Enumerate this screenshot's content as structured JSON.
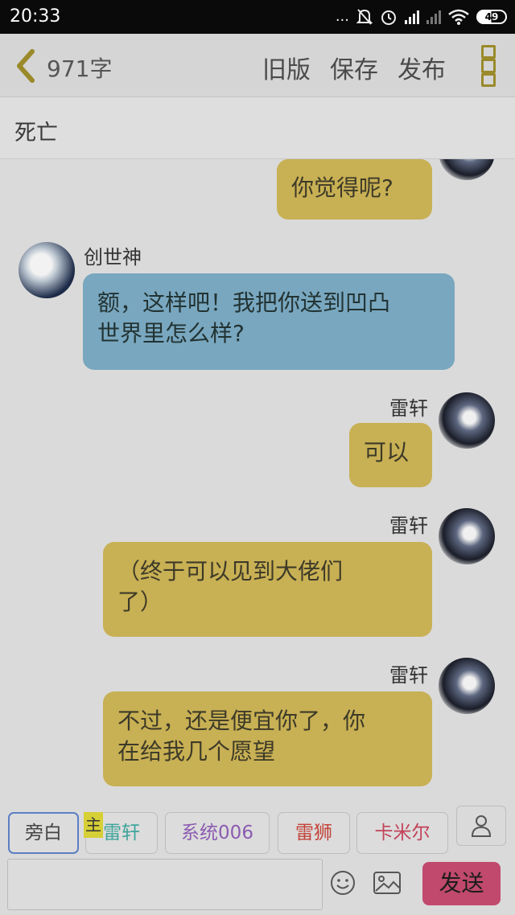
{
  "status_bar": {
    "time": "20:33",
    "battery": "49",
    "dots": "..."
  },
  "header": {
    "word_count": "971字",
    "old_version": "旧版",
    "save": "保存",
    "publish": "发布"
  },
  "chapter": {
    "title": "死亡"
  },
  "messages": [
    {
      "speaker": "",
      "side": "right",
      "text": "你觉得呢?"
    },
    {
      "speaker": "创世神",
      "side": "left",
      "text_lines": [
        "额，这样吧！我把你送到凹凸",
        "世界里怎么样?"
      ]
    },
    {
      "speaker": "雷轩",
      "side": "right",
      "text": "可以"
    },
    {
      "speaker": "雷轩",
      "side": "right",
      "text_lines": [
        "（终于可以见到大佬们",
        "了）"
      ]
    },
    {
      "speaker": "雷轩",
      "side": "right",
      "text_lines": [
        "不过，还是便宜你了，你",
        "在给我几个愿望"
      ]
    }
  ],
  "roles": {
    "narration": "旁白",
    "host_badge": "主",
    "items": [
      {
        "label": "雷轩",
        "color": "#3fa59b"
      },
      {
        "label": "系统006",
        "color": "#8c5bb0"
      },
      {
        "label": "雷狮",
        "color": "#c2443a"
      },
      {
        "label": "卡米尔",
        "color": "#c2445a"
      }
    ]
  },
  "composer": {
    "input_value": "",
    "send": "发送"
  },
  "colors": {
    "bubble_self": "#c8b054",
    "bubble_other": "#79a7bf",
    "send": "#c0496d",
    "active_role_border": "#5b7fc4"
  }
}
